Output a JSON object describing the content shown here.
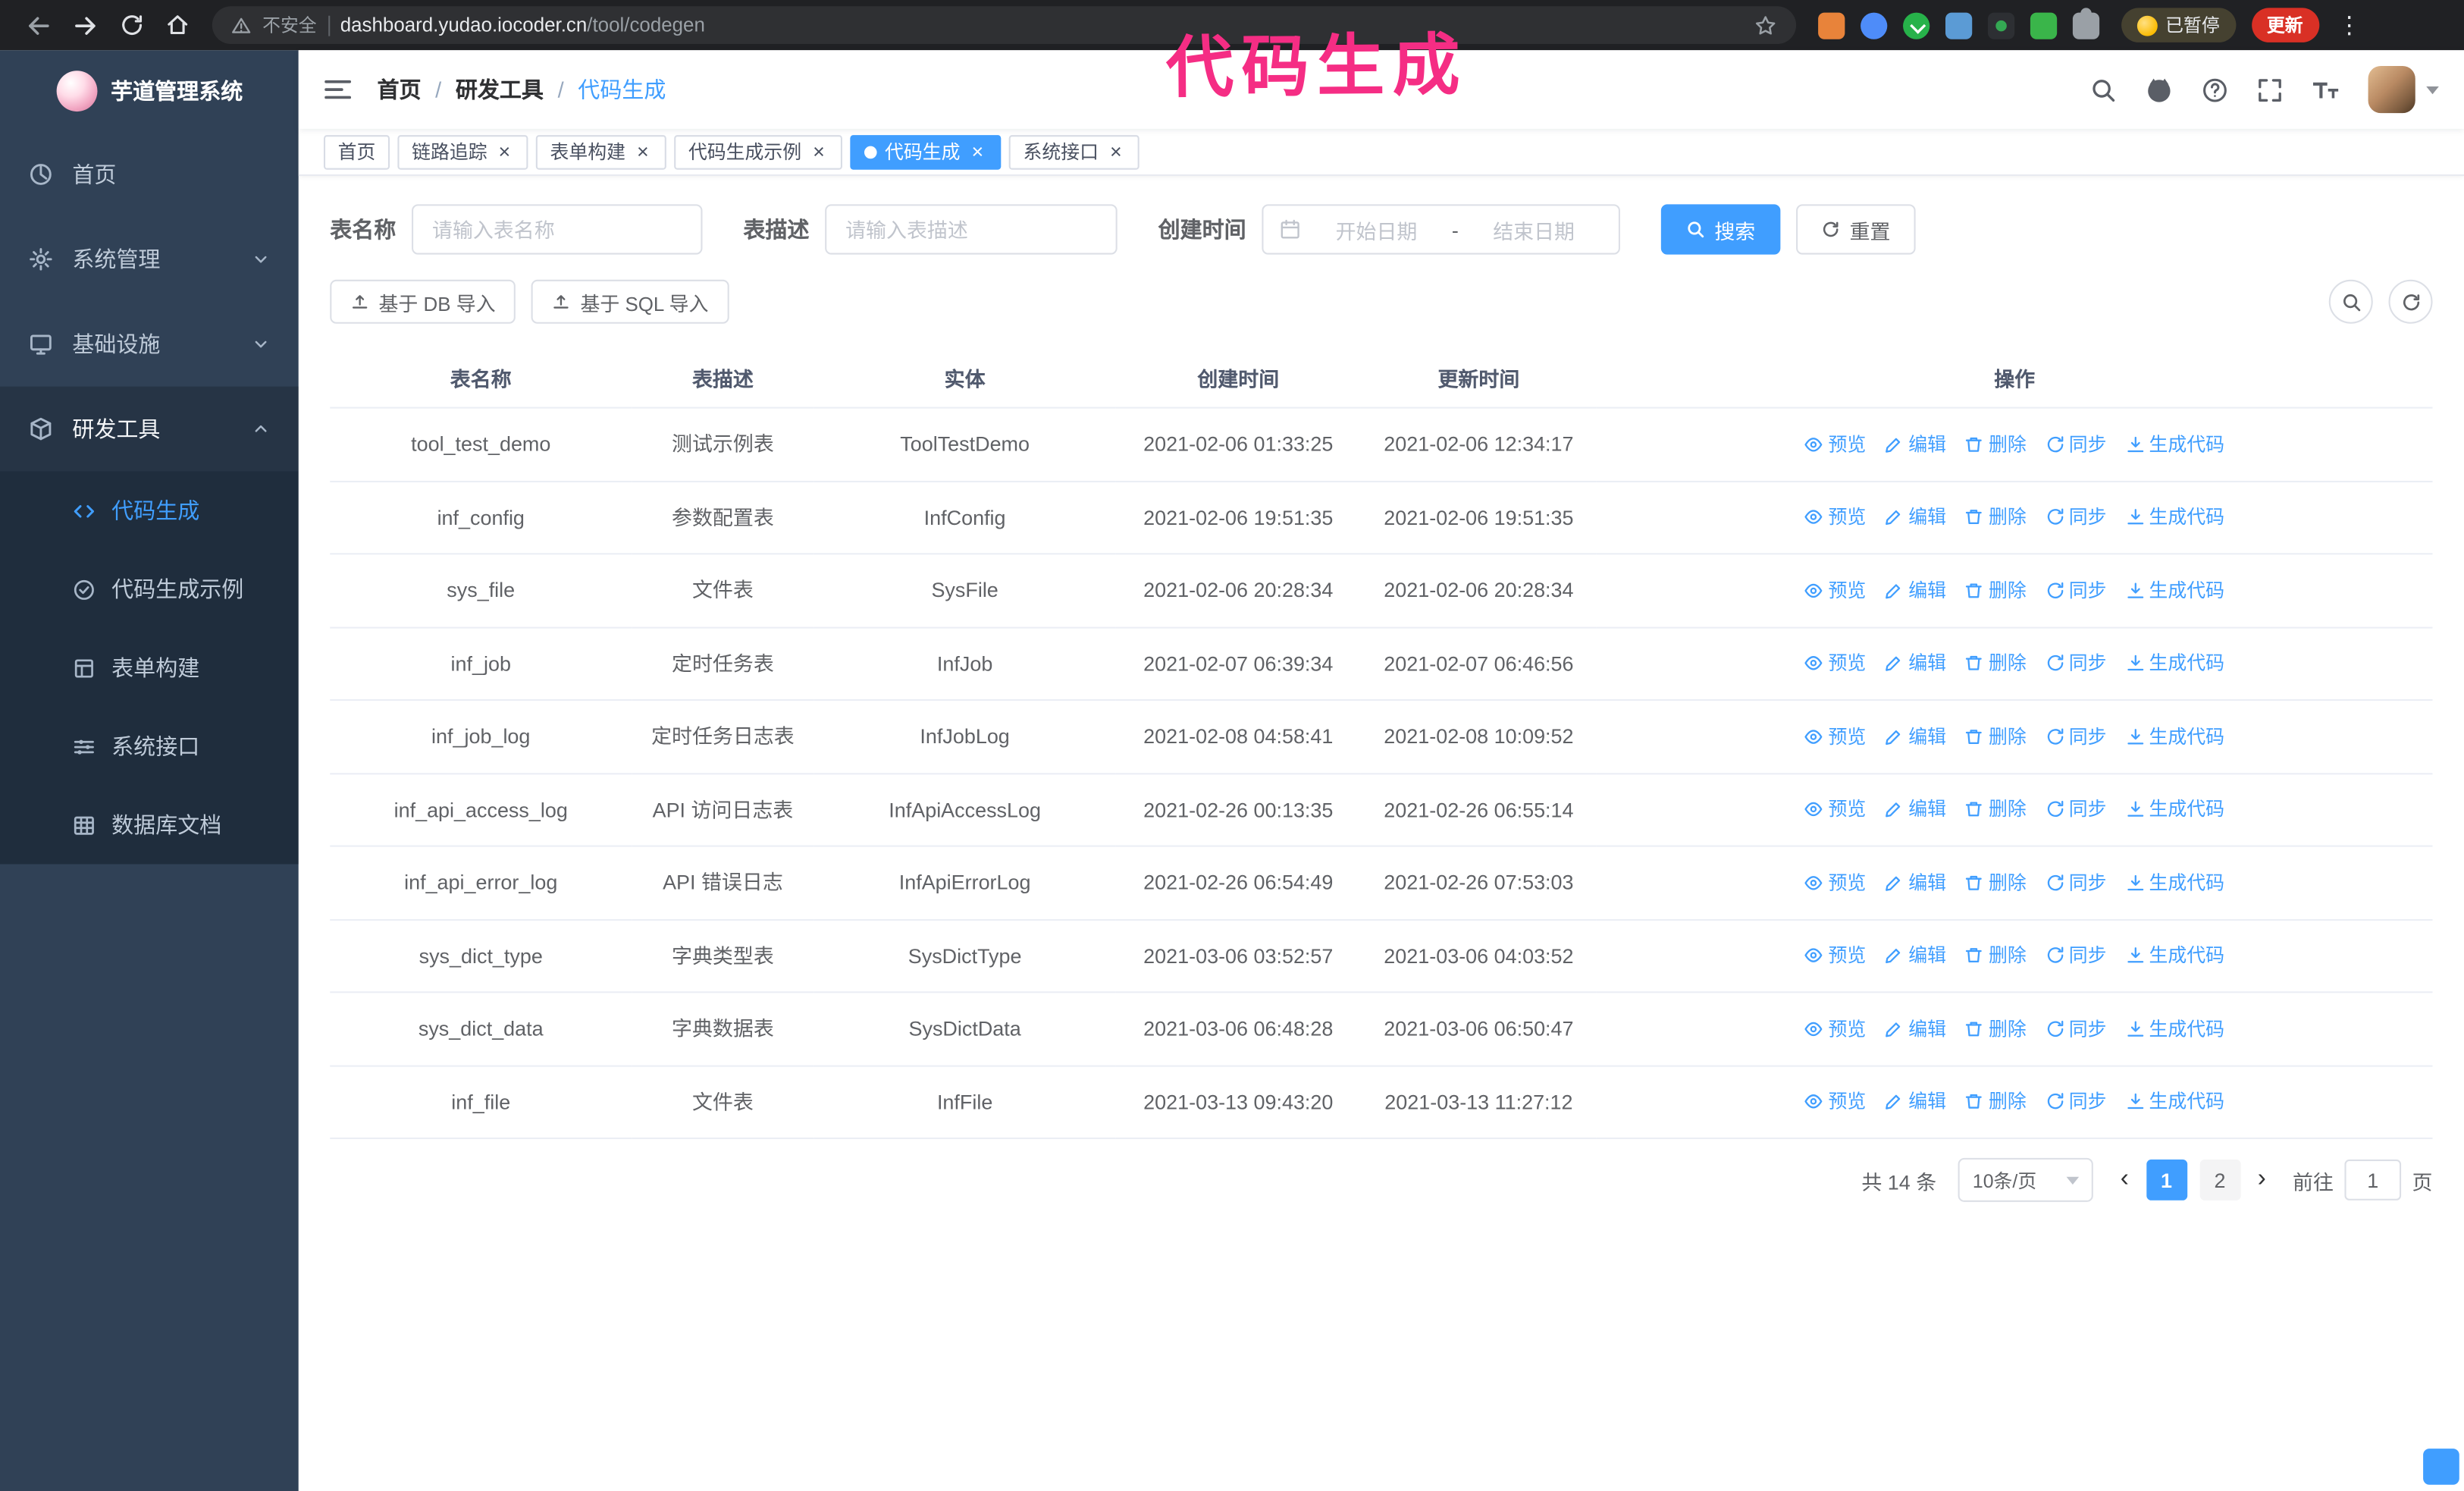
{
  "annotation": {
    "text": "代码生成",
    "color": "#f52d84"
  },
  "browser": {
    "security_label": "不安全",
    "url_host": "dashboard.yudao.iocoder.cn",
    "url_path": "/tool/codegen",
    "paused_badge": "已暂停",
    "update_button": "更新"
  },
  "icons": {
    "close": "×",
    "kebab": "⋮",
    "breadcrumb_sep": "/",
    "prev": "‹",
    "next": "›"
  },
  "sidebar": {
    "logo_title": "芋道管理系统",
    "items": [
      {
        "label": "首页",
        "icon": "home-icon",
        "expandable": false
      },
      {
        "label": "系统管理",
        "icon": "gear-icon",
        "expandable": true
      },
      {
        "label": "基础设施",
        "icon": "infrastructure-icon",
        "expandable": true
      },
      {
        "label": "研发工具",
        "icon": "tools-icon",
        "expandable": true,
        "expanded": true
      }
    ],
    "subitems": [
      {
        "label": "代码生成",
        "icon": "code-icon",
        "active": true
      },
      {
        "label": "代码生成示例",
        "icon": "example-icon",
        "active": false
      },
      {
        "label": "表单构建",
        "icon": "form-icon",
        "active": false
      },
      {
        "label": "系统接口",
        "icon": "api-icon",
        "active": false
      },
      {
        "label": "数据库文档",
        "icon": "database-icon",
        "active": false
      }
    ]
  },
  "header": {
    "breadcrumb": [
      "首页",
      "研发工具",
      "代码生成"
    ]
  },
  "tags": [
    {
      "label": "首页",
      "closable": false,
      "active": false
    },
    {
      "label": "链路追踪",
      "closable": true,
      "active": false
    },
    {
      "label": "表单构建",
      "closable": true,
      "active": false
    },
    {
      "label": "代码生成示例",
      "closable": true,
      "active": false
    },
    {
      "label": "代码生成",
      "closable": true,
      "active": true
    },
    {
      "label": "系统接口",
      "closable": true,
      "active": false
    }
  ],
  "filters": {
    "table_name_label": "表名称",
    "table_name_placeholder": "请输入表名称",
    "table_desc_label": "表描述",
    "table_desc_placeholder": "请输入表描述",
    "create_time_label": "创建时间",
    "date_start_placeholder": "开始日期",
    "date_separator": "-",
    "date_end_placeholder": "结束日期",
    "search_button": "搜索",
    "reset_button": "重置"
  },
  "toolbar": {
    "import_db_button": "基于 DB 导入",
    "import_sql_button": "基于 SQL 导入"
  },
  "table": {
    "columns": [
      "表名称",
      "表描述",
      "实体",
      "创建时间",
      "更新时间",
      "操作"
    ],
    "actions": [
      "预览",
      "编辑",
      "删除",
      "同步",
      "生成代码"
    ],
    "rows": [
      {
        "name": "tool_test_demo",
        "desc": "测试示例表",
        "entity": "ToolTestDemo",
        "created": "2021-02-06 01:33:25",
        "updated": "2021-02-06 12:34:17"
      },
      {
        "name": "inf_config",
        "desc": "参数配置表",
        "entity": "InfConfig",
        "created": "2021-02-06 19:51:35",
        "updated": "2021-02-06 19:51:35"
      },
      {
        "name": "sys_file",
        "desc": "文件表",
        "entity": "SysFile",
        "created": "2021-02-06 20:28:34",
        "updated": "2021-02-06 20:28:34"
      },
      {
        "name": "inf_job",
        "desc": "定时任务表",
        "entity": "InfJob",
        "created": "2021-02-07 06:39:34",
        "updated": "2021-02-07 06:46:56"
      },
      {
        "name": "inf_job_log",
        "desc": "定时任务日志表",
        "entity": "InfJobLog",
        "created": "2021-02-08 04:58:41",
        "updated": "2021-02-08 10:09:52"
      },
      {
        "name": "inf_api_access_log",
        "desc": "API 访问日志表",
        "entity": "InfApiAccessLog",
        "created": "2021-02-26 00:13:35",
        "updated": "2021-02-26 06:55:14"
      },
      {
        "name": "inf_api_error_log",
        "desc": "API 错误日志",
        "entity": "InfApiErrorLog",
        "created": "2021-02-26 06:54:49",
        "updated": "2021-02-26 07:53:03"
      },
      {
        "name": "sys_dict_type",
        "desc": "字典类型表",
        "entity": "SysDictType",
        "created": "2021-03-06 03:52:57",
        "updated": "2021-03-06 04:03:52"
      },
      {
        "name": "sys_dict_data",
        "desc": "字典数据表",
        "entity": "SysDictData",
        "created": "2021-03-06 06:48:28",
        "updated": "2021-03-06 06:50:47"
      },
      {
        "name": "inf_file",
        "desc": "文件表",
        "entity": "InfFile",
        "created": "2021-03-13 09:43:20",
        "updated": "2021-03-13 11:27:12"
      }
    ]
  },
  "pagination": {
    "total": "共 14 条",
    "page_size": "10条/页",
    "pages": [
      "1",
      "2"
    ],
    "active_page": "1",
    "goto_label": "前往",
    "goto_value": "1",
    "goto_suffix": "页"
  },
  "colors": {
    "accent": "#409eff",
    "sidebar_bg": "#304156",
    "submenu_bg": "#1f2d3d",
    "annotation_pink": "#f52d84",
    "update_red": "#d93025"
  }
}
